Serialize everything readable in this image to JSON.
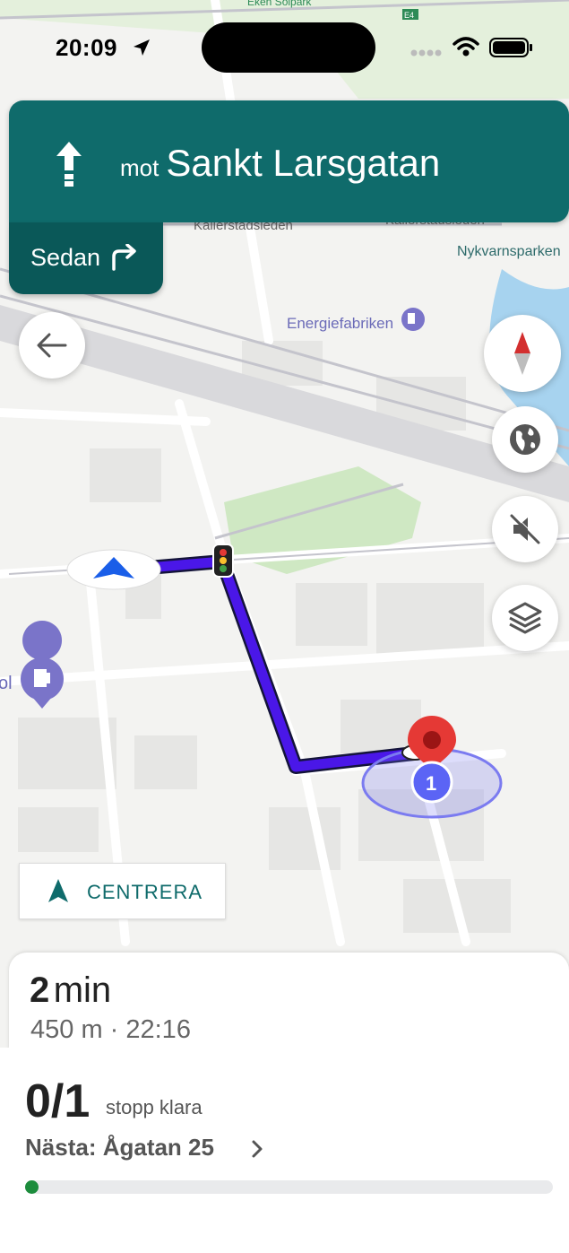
{
  "status_bar": {
    "time": "20:09"
  },
  "map": {
    "labels": {
      "kallerstadsleden_1": "Kallerstadsleden",
      "kallerstadsleden_2": "Kallerstadsleden",
      "nykvarnsparken": "Nykvarnsparken",
      "energiefabriken": "Energiefabriken",
      "eken_solpark": "Eken Solpark",
      "e4_badge": "E4",
      "partial_label": "ol"
    },
    "stop_marker_number": "1"
  },
  "navigation": {
    "direction_prefix": "mot",
    "street": "Sankt Larsgatan",
    "then_label": "Sedan",
    "then_icon": "turn-right-arrow-icon"
  },
  "center_button": {
    "label": "CENTRERA"
  },
  "eta": {
    "duration_value": "2",
    "duration_unit": "min",
    "detail": "450 m · 22:16"
  },
  "stops": {
    "count": "0/1",
    "label": "stopp klara",
    "next": "Nästa: Ågatan 25",
    "progress_fraction": 0.0
  },
  "colors": {
    "banner": "#0f6b6b",
    "route": "#4a17e8",
    "destination": "#e53935",
    "progress": "#1c8c3c"
  }
}
